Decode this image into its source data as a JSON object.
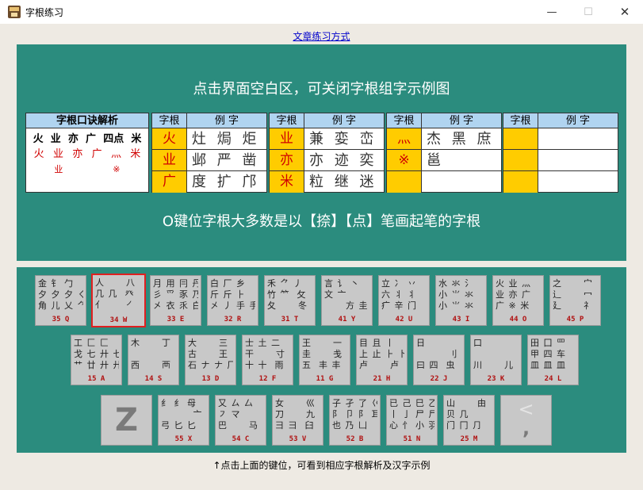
{
  "window": {
    "title": "字根练习",
    "min_symbol": "—",
    "max_symbol": "☐",
    "close_symbol": "✕"
  },
  "article_link": "文章练习方式",
  "top_panel": {
    "hint": "点击界面空白区，可关闭字根组字示例图",
    "analysis": {
      "header": "字根口诀解析",
      "row1": [
        "火",
        "业",
        "亦",
        "广",
        "四点",
        "米"
      ],
      "row2": [
        "火",
        "业",
        "亦",
        "广",
        "灬",
        "米"
      ],
      "row3": [
        "",
        "业",
        "",
        "",
        "※",
        ""
      ]
    },
    "tables": [
      {
        "header_root": "字根",
        "header_examples": "例 字",
        "rows": [
          {
            "root": "火",
            "examples": "灶 焗 炬"
          },
          {
            "root": "业",
            "examples": "邺 严 凿"
          },
          {
            "root": "广",
            "examples": "度 扩 邝"
          }
        ]
      },
      {
        "header_root": "字根",
        "header_examples": "例 字",
        "rows": [
          {
            "root": "业",
            "examples": "兼 娈 峦"
          },
          {
            "root": "亦",
            "examples": "亦 迹 奕"
          },
          {
            "root": "米",
            "examples": "粒 继 迷"
          }
        ]
      },
      {
        "header_root": "字根",
        "header_examples": "例 字",
        "rows": [
          {
            "root": "灬",
            "examples": "杰 黑 庶"
          },
          {
            "root": "※",
            "examples": "邕"
          },
          {
            "root": "",
            "examples": ""
          }
        ]
      },
      {
        "header_root": "字根",
        "header_examples": "例 字",
        "rows": [
          {
            "root": "",
            "examples": ""
          },
          {
            "root": "",
            "examples": ""
          },
          {
            "root": "",
            "examples": ""
          }
        ]
      }
    ],
    "bottom_hint": "O键位字根大多数是以【捺】【点】笔画起笔的字根"
  },
  "keyboard": {
    "row1": [
      {
        "radicals": "金 钅 勹\n夕 夕 夕 ㄑ\n角 儿 乂 ⺈",
        "label": "35 Q"
      },
      {
        "radicals": "人      八\n几 几  癶\n亻      ㇒",
        "label": "34 W"
      },
      {
        "radicals": "月 用 冃 丹\n彡 爫 豕 乃\n㐅 衣 乑 白",
        "label": "33 E"
      },
      {
        "radicals": "白 厂 乡\n斤 斤 ⺊\n㐅 丿 手 手",
        "label": "32 R"
      },
      {
        "radicals": "禾 ⺈ 丿\n竹 ⺮  攵\n夂      冬",
        "label": "31 T"
      },
      {
        "radicals": "言 讠 丶\n文 亠\n      方 圭",
        "label": "41 Y"
      },
      {
        "radicals": "立 冫 丷\n六 丬 丬\n疒 辛 门",
        "label": "42 U"
      },
      {
        "radicals": "水 氺 氵\n小 ⺌ 氺\n小 ⺌ 氺",
        "label": "43 I"
      },
      {
        "radicals": "火 业 灬\n业 亦 广\n广 ※ 米",
        "label": "44 O"
      },
      {
        "radicals": "之      宀\n辶      冖\n廴      礻",
        "label": "45 P"
      }
    ],
    "row2": [
      {
        "radicals": "工 匚 匚\n戈 七 廾 七\n艹 廿 廾 廾",
        "label": "15 A"
      },
      {
        "radicals": "木      丁\n\n西      襾",
        "label": "14 S"
      },
      {
        "radicals": "大      三\n古      王\n石 ナ ナ 厂",
        "label": "13 D"
      },
      {
        "radicals": "士 土 二\n干      寸\n十 十  雨",
        "label": "12 F"
      },
      {
        "radicals": "王      一\n圭      戋\n五  丰 丰",
        "label": "11 G"
      },
      {
        "radicals": "目 且 丨\n上 止 ⺊ 卜\n卢      卢",
        "label": "21 H"
      },
      {
        "radicals": "日      \n         刂 刂\n曰 四  虫",
        "label": "22 J"
      },
      {
        "radicals": "口      \n\n川      儿",
        "label": "23 K"
      },
      {
        "radicals": "田 囗 罒\n甲 四 车\n皿 皿 皿",
        "label": "24 L"
      }
    ],
    "row3": [
      {
        "radicals": "纟 纟 母\n         亠\n弓 匕 匕",
        "label": "55 X"
      },
      {
        "radicals": "又 ㄙ 厶\n㇇ マ\n巴      马",
        "label": "54 C"
      },
      {
        "radicals": "女      巛\n刀      九\n彐 彐  臼",
        "label": "53 V"
      },
      {
        "radicals": "子 孑 了 巜\n阝 卩 阝 耳\n也 乃 凵",
        "label": "52 B"
      },
      {
        "radicals": "已 己 巳 乙\n⼁ ⼅ 尸 尸\n心 忄 小 羽",
        "label": "51 N"
      },
      {
        "radicals": "山      由\n贝 几\n门 冂 ⺆",
        "label": "25 M"
      }
    ],
    "z_key": "Z",
    "punct_key": {
      "top": "<",
      "bottom": ","
    }
  },
  "footer_note": "↑点击上面的键位，可看到相应字根解析及汉字示例",
  "colors": {
    "teal": "#2b8c7e",
    "highlight": "#ffcc00",
    "header_blue": "#b0d4f0",
    "selected_border": "#e02020"
  }
}
